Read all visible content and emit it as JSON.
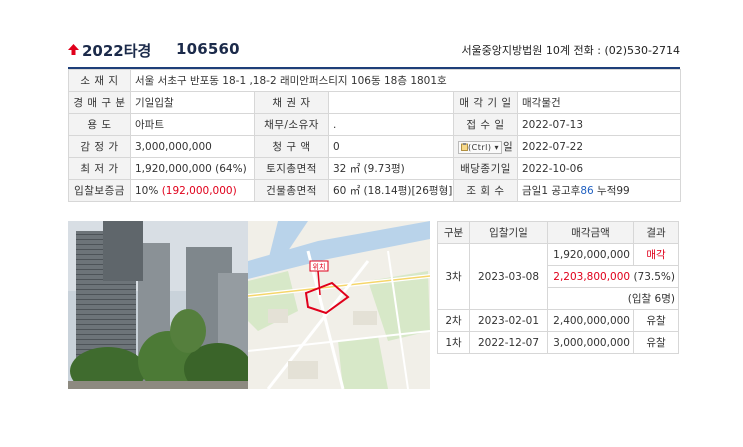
{
  "header": {
    "case_year": "2022타경",
    "case_number": "106560",
    "court_info": "서울중앙지방법원 10계 전화 : (02)530-2714"
  },
  "info": {
    "address_label": "소 재 지",
    "address": "서울 서초구 반포동 18-1 ,18-2 래미안퍼스티지 106동 18층 1801호",
    "type_label": "경 매 구 분",
    "type": "기일입찰",
    "creditor_label": "채 권 자",
    "creditor": "",
    "sale_date_label": "매 각 기 일",
    "sale_date": "매각물건",
    "use_label": "용 도",
    "use": "아파트",
    "debtor_label": "채무/소유자",
    "debtor": ".",
    "receipt_label": "접 수 일",
    "receipt": "2022-07-13",
    "appraisal_label": "감 정 가",
    "appraisal": "3,000,000,000",
    "claim_label": "청 구 액",
    "claim": "0",
    "ctrl_label": "(Ctrl) ▾",
    "start_label": "일",
    "start": "2022-07-22",
    "min_label": "최 저 가",
    "min": "1,920,000,000 (64%)",
    "land_label": "토지총면적",
    "land": "32 ㎡ (9.73평)",
    "dividend_label": "배당종기일",
    "dividend": "2022-10-06",
    "deposit_label": "입찰보증금",
    "deposit_pct": "10% ",
    "deposit_amount": "(192,000,000)",
    "building_label": "건물총면적",
    "building": "60 ㎡ (18.14평)[26평형]",
    "views_label": "조 회 수",
    "views_prefix": "금일1 공고후",
    "views_count": "86",
    "views_total": " 누적99"
  },
  "map": {
    "marker_label": "위치"
  },
  "bids": {
    "headers": [
      "구분",
      "입찰기일",
      "매각금액",
      "결과"
    ],
    "round3": {
      "label": "3차",
      "date": "2023-03-08",
      "min_price": "1,920,000,000",
      "result": "매각",
      "sale_price": "2,203,800,000",
      "sale_pct": "(73.5%)",
      "bidders": "(입찰 6명)"
    },
    "round2": {
      "label": "2차",
      "date": "2023-02-01",
      "price": "2,400,000,000",
      "result": "유찰"
    },
    "round1": {
      "label": "1차",
      "date": "2022-12-07",
      "price": "3,000,000,000",
      "result": "유찰"
    }
  },
  "colors": {
    "accent": "#1e3f79",
    "highlight": "#e0001b",
    "count": "#2060c0"
  }
}
